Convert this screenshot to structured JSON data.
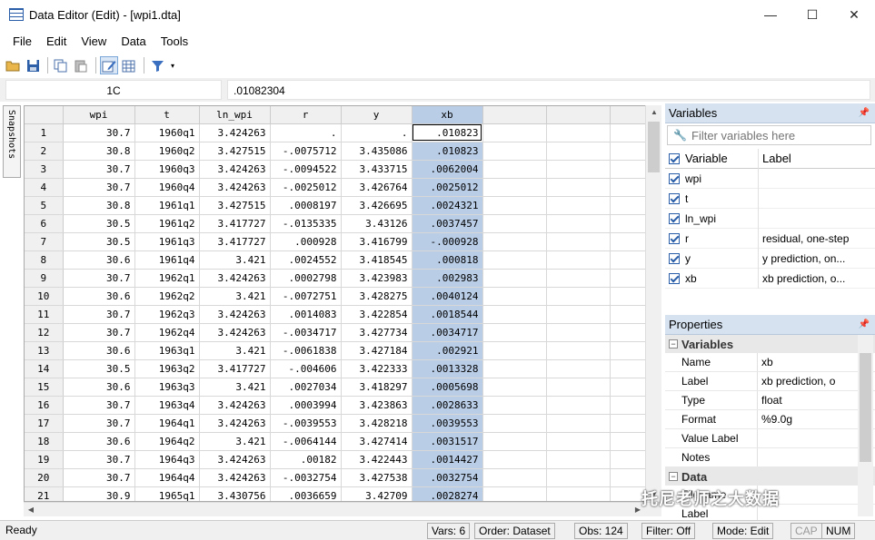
{
  "window": {
    "title": "Data Editor (Edit) - [wpi1.dta]",
    "minimize": "—",
    "maximize": "☐",
    "close": "✕"
  },
  "menu": [
    "File",
    "Edit",
    "View",
    "Data",
    "Tools"
  ],
  "editbar": {
    "cell_ref": "1C",
    "cell_value": ".01082304"
  },
  "snapshots_tab": "Snapshots",
  "grid": {
    "columns": [
      "wpi",
      "t",
      "ln_wpi",
      "r",
      "y",
      "xb"
    ],
    "rows": [
      [
        "1",
        "30.7",
        "1960q1",
        "3.424263",
        ".",
        ".",
        ".010823"
      ],
      [
        "2",
        "30.8",
        "1960q2",
        "3.427515",
        "-.0075712",
        "3.435086",
        ".010823"
      ],
      [
        "3",
        "30.7",
        "1960q3",
        "3.424263",
        "-.0094522",
        "3.433715",
        ".0062004"
      ],
      [
        "4",
        "30.7",
        "1960q4",
        "3.424263",
        "-.0025012",
        "3.426764",
        ".0025012"
      ],
      [
        "5",
        "30.8",
        "1961q1",
        "3.427515",
        ".0008197",
        "3.426695",
        ".0024321"
      ],
      [
        "6",
        "30.5",
        "1961q2",
        "3.417727",
        "-.0135335",
        "3.43126",
        ".0037457"
      ],
      [
        "7",
        "30.5",
        "1961q3",
        "3.417727",
        ".000928",
        "3.416799",
        "-.000928"
      ],
      [
        "8",
        "30.6",
        "1961q4",
        "3.421",
        ".0024552",
        "3.418545",
        ".000818"
      ],
      [
        "9",
        "30.7",
        "1962q1",
        "3.424263",
        ".0002798",
        "3.423983",
        ".002983"
      ],
      [
        "10",
        "30.6",
        "1962q2",
        "3.421",
        "-.0072751",
        "3.428275",
        ".0040124"
      ],
      [
        "11",
        "30.7",
        "1962q3",
        "3.424263",
        ".0014083",
        "3.422854",
        ".0018544"
      ],
      [
        "12",
        "30.7",
        "1962q4",
        "3.424263",
        "-.0034717",
        "3.427734",
        ".0034717"
      ],
      [
        "13",
        "30.6",
        "1963q1",
        "3.421",
        "-.0061838",
        "3.427184",
        ".002921"
      ],
      [
        "14",
        "30.5",
        "1963q2",
        "3.417727",
        "-.004606",
        "3.422333",
        ".0013328"
      ],
      [
        "15",
        "30.6",
        "1963q3",
        "3.421",
        ".0027034",
        "3.418297",
        ".0005698"
      ],
      [
        "16",
        "30.7",
        "1963q4",
        "3.424263",
        ".0003994",
        "3.423863",
        ".0028633"
      ],
      [
        "17",
        "30.7",
        "1964q1",
        "3.424263",
        "-.0039553",
        "3.428218",
        ".0039553"
      ],
      [
        "18",
        "30.6",
        "1964q2",
        "3.421",
        "-.0064144",
        "3.427414",
        ".0031517"
      ],
      [
        "19",
        "30.7",
        "1964q3",
        "3.424263",
        ".00182",
        "3.422443",
        ".0014427"
      ],
      [
        "20",
        "30.7",
        "1964q4",
        "3.424263",
        "-.0032754",
        "3.427538",
        ".0032754"
      ],
      [
        "21",
        "30.9",
        "1965q1",
        "3.430756",
        ".0036659",
        "3.42709",
        ".0028274"
      ]
    ]
  },
  "variables_panel": {
    "title": "Variables",
    "filter_placeholder": "Filter variables here",
    "col_variable": "Variable",
    "col_label": "Label",
    "items": [
      {
        "name": "wpi",
        "label": ""
      },
      {
        "name": "t",
        "label": ""
      },
      {
        "name": "ln_wpi",
        "label": ""
      },
      {
        "name": "r",
        "label": "residual, one-step"
      },
      {
        "name": "y",
        "label": "y prediction, on..."
      },
      {
        "name": "xb",
        "label": "xb prediction, o..."
      }
    ]
  },
  "properties_panel": {
    "title": "Properties",
    "section_variables": "Variables",
    "rows": [
      {
        "key": "Name",
        "value": "xb"
      },
      {
        "key": "Label",
        "value": "xb prediction, o"
      },
      {
        "key": "Type",
        "value": "float"
      },
      {
        "key": "Format",
        "value": "%9.0g"
      },
      {
        "key": "Value Label",
        "value": ""
      },
      {
        "key": "Notes",
        "value": ""
      }
    ],
    "section_data": "Data",
    "data_rows": [
      {
        "key": "Filename",
        "value": ""
      },
      {
        "key": "Label",
        "value": ""
      }
    ]
  },
  "watermark": "托尼老师之大数据",
  "statusbar": {
    "ready": "Ready",
    "vars": "Vars: 6",
    "order": "Order: Dataset",
    "obs": "Obs: 124",
    "filter": "Filter: Off",
    "mode": "Mode: Edit",
    "cap": "CAP",
    "num": "NUM"
  }
}
